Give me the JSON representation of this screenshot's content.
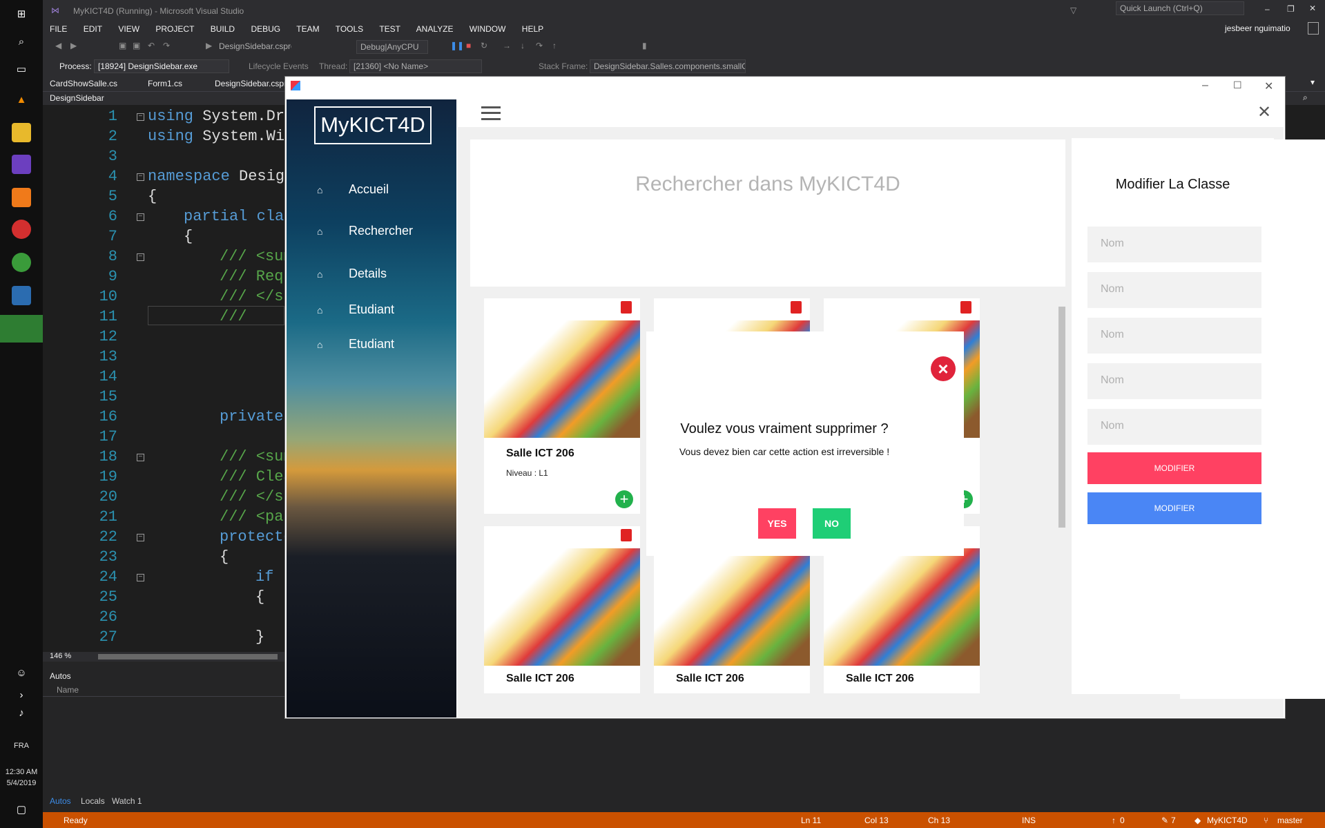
{
  "taskbar": {
    "time": "12:30 AM",
    "date": "5/4/2019",
    "lang": "FRA"
  },
  "vs": {
    "title": "MyKICT4D (Running) - Microsoft Visual Studio",
    "quick_launch": "Quick Launch (Ctrl+Q)",
    "user": "jesbeer nguimatio",
    "menu": [
      "FILE",
      "EDIT",
      "VIEW",
      "PROJECT",
      "BUILD",
      "DEBUG",
      "TEAM",
      "TOOLS",
      "TEST",
      "ANALYZE",
      "WINDOW",
      "HELP"
    ],
    "toolbar": {
      "project": "DesignSidebar.csproj",
      "config": "Debug|AnyCPU"
    },
    "process_label": "Process:",
    "process": "[18924] DesignSidebar.exe",
    "lifecycle": "Lifecycle Events",
    "thread_label": "Thread:",
    "thread": "[21360] <No Name>",
    "stack_label": "Stack Frame:",
    "stack_frame": "DesignSidebar.Salles.components.smallCc",
    "tabs": [
      "CardShowSalle.cs",
      "Form1.cs",
      "DesignSidebar.cspr"
    ],
    "nav_file": "DesignSidebar",
    "zoom": "146 %",
    "autos": {
      "title": "Autos",
      "column": "Name",
      "tabs": [
        "Autos",
        "Locals",
        "Watch 1"
      ]
    },
    "status": {
      "ready": "Ready",
      "ln": "Ln 11",
      "col": "Col 13",
      "ch": "Ch 13",
      "ins": "INS",
      "up": "0",
      "edits": "7",
      "repo": "MyKICT4D",
      "branch": "master"
    }
  },
  "code": {
    "lines": [
      "1",
      "2",
      "3",
      "4",
      "5",
      "6",
      "7",
      "8",
      "9",
      "10",
      "11",
      "12",
      "13",
      "14",
      "15",
      "16",
      "17",
      "18",
      "19",
      "20",
      "21",
      "22",
      "23",
      "24",
      "25",
      "26",
      "27"
    ],
    "l1a": "using",
    "l1b": " System.Dra",
    "l2a": "using",
    "l2b": " System.Wir",
    "l4a": "namespace",
    "l4b": " Design",
    "l5": "{",
    "l6a": "partial",
    "l6b": " clas",
    "l7": "{",
    "l8": "/// <sum",
    "l9": "/// Requ",
    "l10": "/// </su",
    "l11": "///",
    "l16": "private",
    "l18": "/// <sum",
    "l19": "/// Clea",
    "l20": "/// </su",
    "l21": "/// <par",
    "l22": "protecte",
    "l23": "{",
    "l24": "if",
    "l25": "{",
    "l27": "}"
  },
  "app": {
    "logo": "MyKICT4D",
    "nav": [
      {
        "label": "Accueil"
      },
      {
        "label": "Rechercher"
      },
      {
        "label": "Details"
      },
      {
        "label": "Etudiant"
      },
      {
        "label": "Etudiant"
      }
    ],
    "search_text": "Rechercher dans MyKICT4D",
    "cards": [
      {
        "title": "Salle ICT 206",
        "level_label": "Niveau :",
        "level": "L1"
      },
      {
        "title": "Salle ICT 206"
      },
      {
        "title": "Salle ICT 206"
      },
      {
        "title": "Salle ICT 206"
      }
    ],
    "edit_panel": {
      "title": "Modifier La Classe",
      "fields": [
        "Nom",
        "Nom",
        "Nom",
        "Nom",
        "Nom"
      ],
      "btn_primary": "MODIFIER",
      "btn_secondary": "MODIFIER"
    },
    "dialog": {
      "title": "Voulez vous vraiment supprimer ?",
      "message": "Vous devez bien car cette action est irreversible !",
      "yes": "YES",
      "no": "NO"
    },
    "colors": {
      "modifier_red": "#ff4162",
      "modifier_blue": "#4a86f5",
      "yes": "#ff4162",
      "no": "#1fce76",
      "plus": "#22b14c"
    }
  }
}
